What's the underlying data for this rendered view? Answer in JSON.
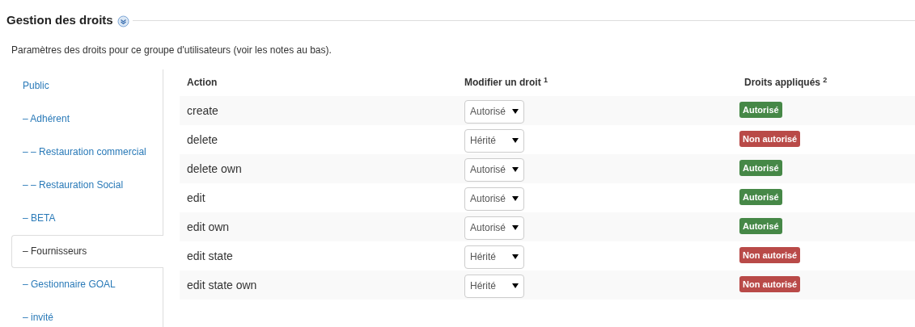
{
  "section": {
    "title": "Gestion des droits",
    "description": "Paramètres des droits pour ce groupe d'utilisateurs (voir les notes au bas)."
  },
  "groups": [
    {
      "label": "Public",
      "selected": false
    },
    {
      "label": "– Adhérent",
      "selected": false
    },
    {
      "label": "– – Restauration commercial",
      "selected": false
    },
    {
      "label": "– – Restauration Social",
      "selected": false
    },
    {
      "label": "– BETA",
      "selected": false
    },
    {
      "label": "– Fournisseurs",
      "selected": true
    },
    {
      "label": "– Gestionnaire GOAL",
      "selected": false
    },
    {
      "label": "– invité",
      "selected": false
    }
  ],
  "table": {
    "columns": [
      "Action",
      "Modifier un droit $^{1}$",
      "Droits appliqués $^{2}$"
    ],
    "rows": [
      {
        "action": "create",
        "setting": "Autorisé",
        "applied": {
          "text": "Autorisé",
          "kind": "allowed"
        }
      },
      {
        "action": "delete",
        "setting": "Hérité",
        "applied": {
          "text": "Non autorisé",
          "kind": "denied"
        }
      },
      {
        "action": "delete own",
        "setting": "Autorisé",
        "applied": {
          "text": "Autorisé",
          "kind": "allowed"
        }
      },
      {
        "action": "edit",
        "setting": "Autorisé",
        "applied": {
          "text": "Autorisé",
          "kind": "allowed"
        }
      },
      {
        "action": "edit own",
        "setting": "Autorisé",
        "applied": {
          "text": "Autorisé",
          "kind": "allowed"
        }
      },
      {
        "action": "edit state",
        "setting": "Hérité",
        "applied": {
          "text": "Non autorisé",
          "kind": "denied"
        }
      },
      {
        "action": "edit state own",
        "setting": "Hérité",
        "applied": {
          "text": "Non autorisé",
          "kind": "denied"
        }
      }
    ]
  }
}
